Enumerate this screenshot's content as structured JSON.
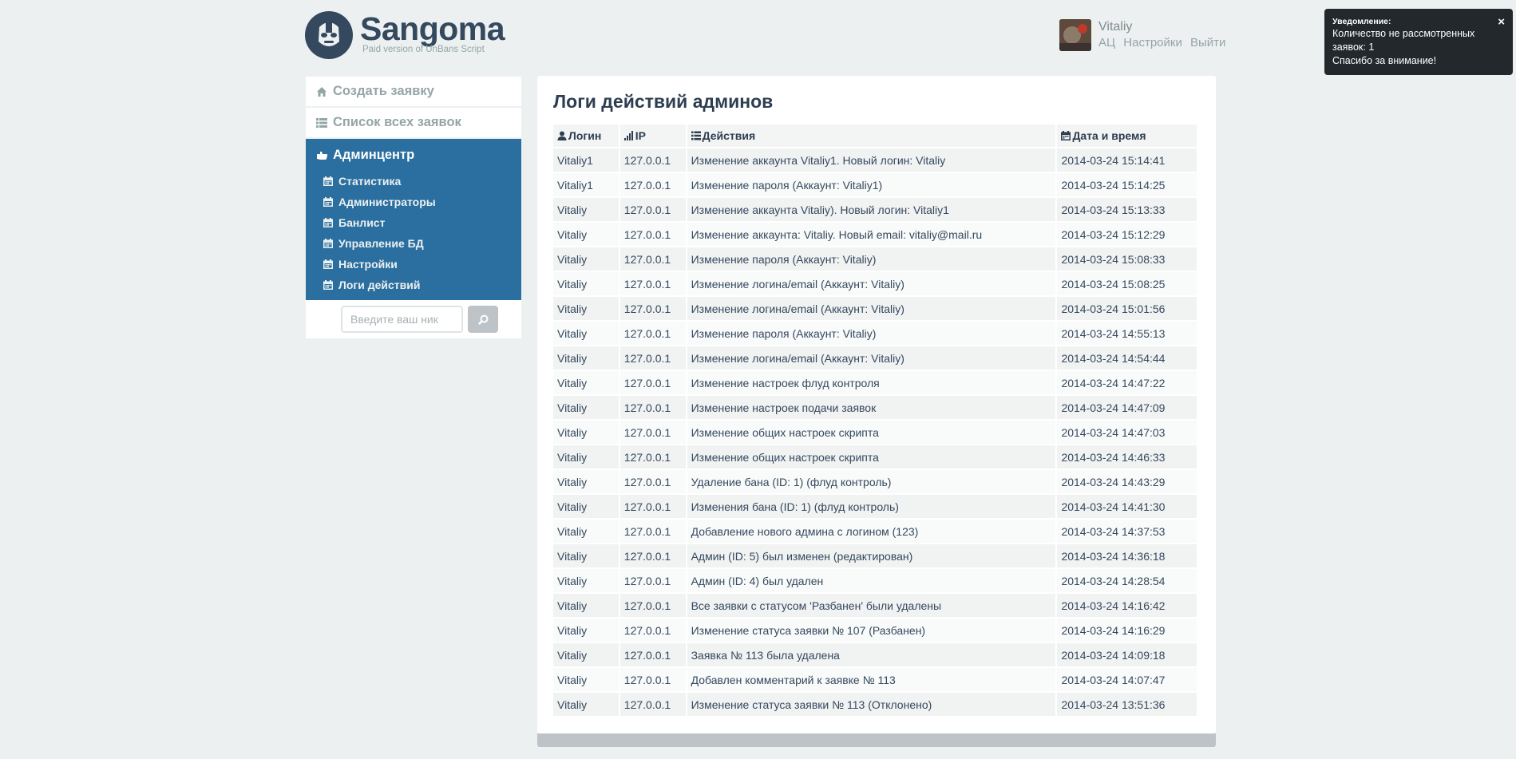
{
  "header": {
    "logo_title": "Sangoma",
    "logo_subtitle": "Paid version of UnBans Script",
    "user_name": "Vitaliy",
    "links": [
      "АЦ",
      "Настройки",
      "Выйти"
    ]
  },
  "notification": {
    "title": "Уведомление:",
    "line1": "Количество не рассмотренных заявок: 1",
    "line2": "Спасибо за внимание!",
    "close": "×"
  },
  "sidebar": {
    "create_request": "Создать заявку",
    "all_requests": "Список всех заявок",
    "admin_center": "Админцентр",
    "sub_items": [
      "Статистика",
      "Администраторы",
      "Банлист",
      "Управление БД",
      "Настройки",
      "Логи действий"
    ],
    "search_placeholder": "Введите ваш ник"
  },
  "main": {
    "title": "Логи действий админов",
    "columns": [
      "Логин",
      "IP",
      "Действия",
      "Дата и время"
    ],
    "rows": [
      [
        "Vitaliy1",
        "127.0.0.1",
        "Изменение аккаунта Vitaliy1. Новый логин: Vitaliy",
        "2014-03-24 15:14:41"
      ],
      [
        "Vitaliy1",
        "127.0.0.1",
        "Изменение пароля (Аккаунт: Vitaliy1)",
        "2014-03-24 15:14:25"
      ],
      [
        "Vitaliy",
        "127.0.0.1",
        "Изменение аккаунта Vitaliy). Новый логин: Vitaliy1",
        "2014-03-24 15:13:33"
      ],
      [
        "Vitaliy",
        "127.0.0.1",
        "Изменение аккаунта: Vitaliy. Новый email: vitaliy@mail.ru",
        "2014-03-24 15:12:29"
      ],
      [
        "Vitaliy",
        "127.0.0.1",
        "Изменение пароля (Аккаунт: Vitaliy)",
        "2014-03-24 15:08:33"
      ],
      [
        "Vitaliy",
        "127.0.0.1",
        "Изменение логина/email (Аккаунт: Vitaliy)",
        "2014-03-24 15:08:25"
      ],
      [
        "Vitaliy",
        "127.0.0.1",
        "Изменение логина/email (Аккаунт: Vitaliy)",
        "2014-03-24 15:01:56"
      ],
      [
        "Vitaliy",
        "127.0.0.1",
        "Изменение пароля (Аккаунт: Vitaliy)",
        "2014-03-24 14:55:13"
      ],
      [
        "Vitaliy",
        "127.0.0.1",
        "Изменение логина/email (Аккаунт: Vitaliy)",
        "2014-03-24 14:54:44"
      ],
      [
        "Vitaliy",
        "127.0.0.1",
        "Изменение настроек флуд контроля",
        "2014-03-24 14:47:22"
      ],
      [
        "Vitaliy",
        "127.0.0.1",
        "Изменение настроек подачи заявок",
        "2014-03-24 14:47:09"
      ],
      [
        "Vitaliy",
        "127.0.0.1",
        "Изменение общих настроек скрипта",
        "2014-03-24 14:47:03"
      ],
      [
        "Vitaliy",
        "127.0.0.1",
        "Изменение общих настроек скрипта",
        "2014-03-24 14:46:33"
      ],
      [
        "Vitaliy",
        "127.0.0.1",
        "Удаление бана (ID: 1) (флуд контроль)",
        "2014-03-24 14:43:29"
      ],
      [
        "Vitaliy",
        "127.0.0.1",
        "Изменения бана (ID: 1) (флуд контроль)",
        "2014-03-24 14:41:30"
      ],
      [
        "Vitaliy",
        "127.0.0.1",
        "Добавление нового админа с логином (123)",
        "2014-03-24 14:37:53"
      ],
      [
        "Vitaliy",
        "127.0.0.1",
        "Админ (ID: 5) был изменен (редактирован)",
        "2014-03-24 14:36:18"
      ],
      [
        "Vitaliy",
        "127.0.0.1",
        "Админ (ID: 4) был удален",
        "2014-03-24 14:28:54"
      ],
      [
        "Vitaliy",
        "127.0.0.1",
        "Все заявки с статусом 'Разбанен' были удалены",
        "2014-03-24 14:16:42"
      ],
      [
        "Vitaliy",
        "127.0.0.1",
        "Изменение статуса заявки № 107 (Разбанен)",
        "2014-03-24 14:16:29"
      ],
      [
        "Vitaliy",
        "127.0.0.1",
        "Заявка № 113 была удалена",
        "2014-03-24 14:09:18"
      ],
      [
        "Vitaliy",
        "127.0.0.1",
        "Добавлен комментарий к заявке № 113",
        "2014-03-24 14:07:47"
      ],
      [
        "Vitaliy",
        "127.0.0.1",
        "Изменение статуса заявки № 113 (Отклонено)",
        "2014-03-24 13:51:36"
      ]
    ]
  },
  "colors": {
    "background": "#ecf0f1",
    "admin_nav": "#2a6fa0",
    "text_dark": "#2c3e50",
    "muted": "#95a5a6",
    "notice_bg": "#22282c",
    "bottom_bar": "#bdc3c7"
  },
  "icons": {
    "logo": "mask-logo-icon",
    "create": "home-icon",
    "list": "list-icon",
    "admin": "hand-icon",
    "sub": "calendar-icon",
    "search": "search-icon",
    "login_col": "user-icon",
    "ip_col": "signal-icon",
    "action_col": "list-icon",
    "date_col": "calendar-icon"
  }
}
